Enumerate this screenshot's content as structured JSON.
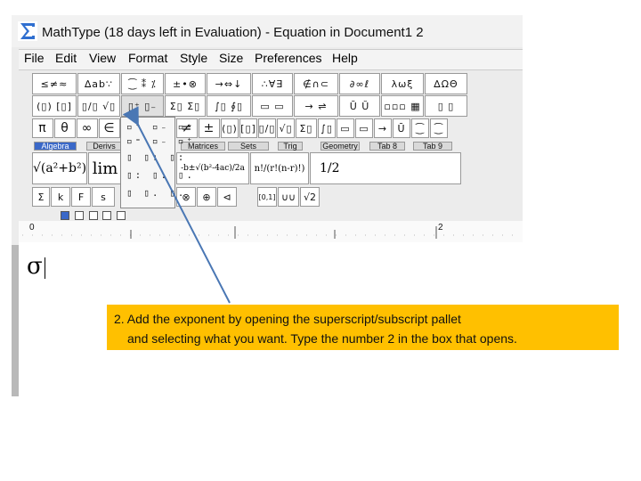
{
  "window": {
    "title": "MathType (18 days left in Evaluation) - Equation in Document1 2"
  },
  "menu": [
    "File",
    "Edit",
    "View",
    "Format",
    "Style",
    "Size",
    "Preferences",
    "Help"
  ],
  "symbol_palette_row1": [
    "≤≠≈",
    "∆ab∵",
    "⁐ ⁑ ⁒",
    "±•⊗",
    "→⇔↓",
    "∴∀∃",
    "∉∩⊂",
    "∂∞ℓ",
    "λωξ",
    "∆ΩΘ"
  ],
  "symbol_palette_row2": [
    "(▯) [▯]",
    "▯/▯ √▯",
    "▯⁺ ▯₋",
    "Σ▯ Σ▯",
    "∫▯ ∮▯",
    "▭ ▭",
    "→ ⇌",
    "Ū Ŭ",
    "▫▫▫ ▦",
    "▯ ▯"
  ],
  "small_bar": [
    "π",
    "θ",
    "∞",
    "∈",
    "≠",
    "±",
    "(▯)",
    "[▯]",
    "▯/▯",
    "√▯",
    "Σ▯",
    "∫▯",
    "▭",
    "▭",
    "→",
    "Ū",
    "⁐",
    "⁐"
  ],
  "tabs": [
    "Algebra",
    "Derivs",
    "Matrices",
    "Sets",
    "Trig",
    "Geometry",
    "Tab 8",
    "Tab 9"
  ],
  "templates": [
    "√(a²+b²)",
    "lim",
    "-b±√(b²-4ac)/2a",
    "n!/(r!(n-r)!)",
    "1/2"
  ],
  "template_bar2": [
    "Σ",
    "k",
    "F",
    "s",
    "⊗",
    "⊕",
    "⊲",
    "[0,1]",
    "∪∪",
    "√2"
  ],
  "ruler": {
    "start": "0",
    "mark": "2"
  },
  "equation": {
    "symbol": "σ"
  },
  "callout": {
    "line1": "2. Add the exponent by opening the superscript/subscript pallet",
    "line2": "and selecting what you want. Type the number 2 in the box that opens."
  },
  "colors": {
    "callout_bg": "#ffc000",
    "arrow": "#4a77b4",
    "tab_active": "#3a68c8"
  }
}
